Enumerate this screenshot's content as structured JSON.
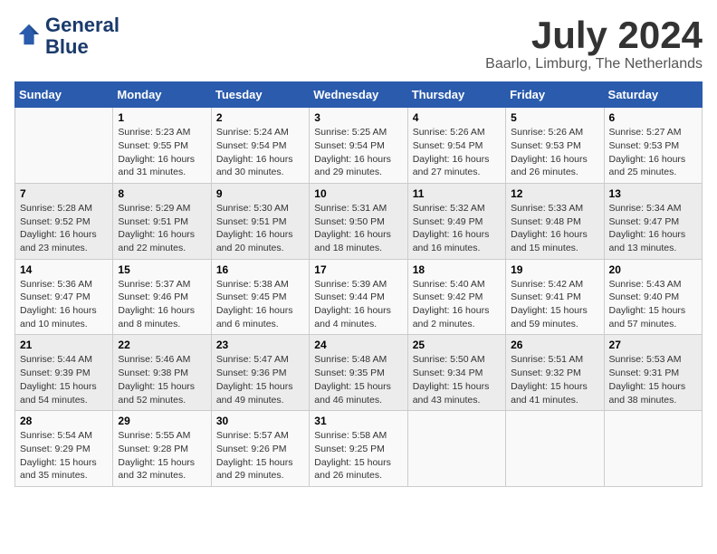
{
  "logo": {
    "line1": "General",
    "line2": "Blue"
  },
  "title": "July 2024",
  "location": "Baarlo, Limburg, The Netherlands",
  "days_header": [
    "Sunday",
    "Monday",
    "Tuesday",
    "Wednesday",
    "Thursday",
    "Friday",
    "Saturday"
  ],
  "weeks": [
    [
      {
        "day": "",
        "sunrise": "",
        "sunset": "",
        "daylight": ""
      },
      {
        "day": "1",
        "sunrise": "Sunrise: 5:23 AM",
        "sunset": "Sunset: 9:55 PM",
        "daylight": "Daylight: 16 hours and 31 minutes."
      },
      {
        "day": "2",
        "sunrise": "Sunrise: 5:24 AM",
        "sunset": "Sunset: 9:54 PM",
        "daylight": "Daylight: 16 hours and 30 minutes."
      },
      {
        "day": "3",
        "sunrise": "Sunrise: 5:25 AM",
        "sunset": "Sunset: 9:54 PM",
        "daylight": "Daylight: 16 hours and 29 minutes."
      },
      {
        "day": "4",
        "sunrise": "Sunrise: 5:26 AM",
        "sunset": "Sunset: 9:54 PM",
        "daylight": "Daylight: 16 hours and 27 minutes."
      },
      {
        "day": "5",
        "sunrise": "Sunrise: 5:26 AM",
        "sunset": "Sunset: 9:53 PM",
        "daylight": "Daylight: 16 hours and 26 minutes."
      },
      {
        "day": "6",
        "sunrise": "Sunrise: 5:27 AM",
        "sunset": "Sunset: 9:53 PM",
        "daylight": "Daylight: 16 hours and 25 minutes."
      }
    ],
    [
      {
        "day": "7",
        "sunrise": "Sunrise: 5:28 AM",
        "sunset": "Sunset: 9:52 PM",
        "daylight": "Daylight: 16 hours and 23 minutes."
      },
      {
        "day": "8",
        "sunrise": "Sunrise: 5:29 AM",
        "sunset": "Sunset: 9:51 PM",
        "daylight": "Daylight: 16 hours and 22 minutes."
      },
      {
        "day": "9",
        "sunrise": "Sunrise: 5:30 AM",
        "sunset": "Sunset: 9:51 PM",
        "daylight": "Daylight: 16 hours and 20 minutes."
      },
      {
        "day": "10",
        "sunrise": "Sunrise: 5:31 AM",
        "sunset": "Sunset: 9:50 PM",
        "daylight": "Daylight: 16 hours and 18 minutes."
      },
      {
        "day": "11",
        "sunrise": "Sunrise: 5:32 AM",
        "sunset": "Sunset: 9:49 PM",
        "daylight": "Daylight: 16 hours and 16 minutes."
      },
      {
        "day": "12",
        "sunrise": "Sunrise: 5:33 AM",
        "sunset": "Sunset: 9:48 PM",
        "daylight": "Daylight: 16 hours and 15 minutes."
      },
      {
        "day": "13",
        "sunrise": "Sunrise: 5:34 AM",
        "sunset": "Sunset: 9:47 PM",
        "daylight": "Daylight: 16 hours and 13 minutes."
      }
    ],
    [
      {
        "day": "14",
        "sunrise": "Sunrise: 5:36 AM",
        "sunset": "Sunset: 9:47 PM",
        "daylight": "Daylight: 16 hours and 10 minutes."
      },
      {
        "day": "15",
        "sunrise": "Sunrise: 5:37 AM",
        "sunset": "Sunset: 9:46 PM",
        "daylight": "Daylight: 16 hours and 8 minutes."
      },
      {
        "day": "16",
        "sunrise": "Sunrise: 5:38 AM",
        "sunset": "Sunset: 9:45 PM",
        "daylight": "Daylight: 16 hours and 6 minutes."
      },
      {
        "day": "17",
        "sunrise": "Sunrise: 5:39 AM",
        "sunset": "Sunset: 9:44 PM",
        "daylight": "Daylight: 16 hours and 4 minutes."
      },
      {
        "day": "18",
        "sunrise": "Sunrise: 5:40 AM",
        "sunset": "Sunset: 9:42 PM",
        "daylight": "Daylight: 16 hours and 2 minutes."
      },
      {
        "day": "19",
        "sunrise": "Sunrise: 5:42 AM",
        "sunset": "Sunset: 9:41 PM",
        "daylight": "Daylight: 15 hours and 59 minutes."
      },
      {
        "day": "20",
        "sunrise": "Sunrise: 5:43 AM",
        "sunset": "Sunset: 9:40 PM",
        "daylight": "Daylight: 15 hours and 57 minutes."
      }
    ],
    [
      {
        "day": "21",
        "sunrise": "Sunrise: 5:44 AM",
        "sunset": "Sunset: 9:39 PM",
        "daylight": "Daylight: 15 hours and 54 minutes."
      },
      {
        "day": "22",
        "sunrise": "Sunrise: 5:46 AM",
        "sunset": "Sunset: 9:38 PM",
        "daylight": "Daylight: 15 hours and 52 minutes."
      },
      {
        "day": "23",
        "sunrise": "Sunrise: 5:47 AM",
        "sunset": "Sunset: 9:36 PM",
        "daylight": "Daylight: 15 hours and 49 minutes."
      },
      {
        "day": "24",
        "sunrise": "Sunrise: 5:48 AM",
        "sunset": "Sunset: 9:35 PM",
        "daylight": "Daylight: 15 hours and 46 minutes."
      },
      {
        "day": "25",
        "sunrise": "Sunrise: 5:50 AM",
        "sunset": "Sunset: 9:34 PM",
        "daylight": "Daylight: 15 hours and 43 minutes."
      },
      {
        "day": "26",
        "sunrise": "Sunrise: 5:51 AM",
        "sunset": "Sunset: 9:32 PM",
        "daylight": "Daylight: 15 hours and 41 minutes."
      },
      {
        "day": "27",
        "sunrise": "Sunrise: 5:53 AM",
        "sunset": "Sunset: 9:31 PM",
        "daylight": "Daylight: 15 hours and 38 minutes."
      }
    ],
    [
      {
        "day": "28",
        "sunrise": "Sunrise: 5:54 AM",
        "sunset": "Sunset: 9:29 PM",
        "daylight": "Daylight: 15 hours and 35 minutes."
      },
      {
        "day": "29",
        "sunrise": "Sunrise: 5:55 AM",
        "sunset": "Sunset: 9:28 PM",
        "daylight": "Daylight: 15 hours and 32 minutes."
      },
      {
        "day": "30",
        "sunrise": "Sunrise: 5:57 AM",
        "sunset": "Sunset: 9:26 PM",
        "daylight": "Daylight: 15 hours and 29 minutes."
      },
      {
        "day": "31",
        "sunrise": "Sunrise: 5:58 AM",
        "sunset": "Sunset: 9:25 PM",
        "daylight": "Daylight: 15 hours and 26 minutes."
      },
      {
        "day": "",
        "sunrise": "",
        "sunset": "",
        "daylight": ""
      },
      {
        "day": "",
        "sunrise": "",
        "sunset": "",
        "daylight": ""
      },
      {
        "day": "",
        "sunrise": "",
        "sunset": "",
        "daylight": ""
      }
    ]
  ]
}
